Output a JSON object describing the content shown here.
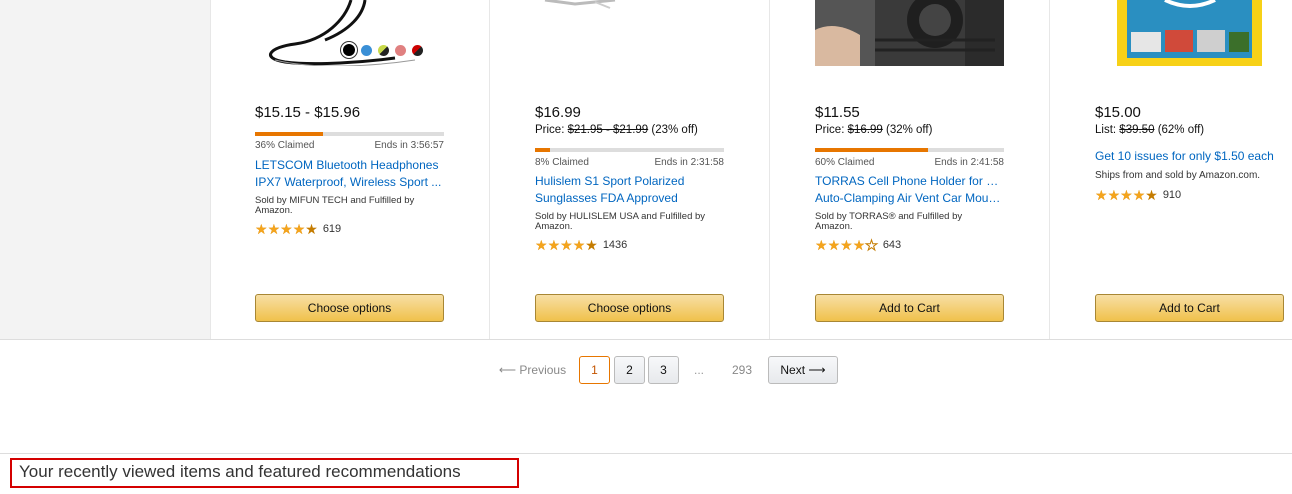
{
  "deals": [
    {
      "price": "$15.15 - $15.96",
      "claimed_percent": 36,
      "claimed_text": "36% Claimed",
      "ends_text": "Ends in 3:56:57",
      "title_line1": "LETSCOM Bluetooth Headphones",
      "title_line2": "IPX7 Waterproof, Wireless Sport ...",
      "sold_by_line1": "Sold by MIFUN TECH and Fulfilled by",
      "sold_by_line2": "Amazon.",
      "rating_stars": 4.5,
      "review_count": "619",
      "button_label": "Choose options"
    },
    {
      "price": "$16.99",
      "list_label": "Price:",
      "list_price": "$21.95 - $21.99",
      "discount": "(23% off)",
      "claimed_percent": 8,
      "claimed_text": "8% Claimed",
      "ends_text": "Ends in 2:31:58",
      "title_line1": "Hulislem S1 Sport Polarized",
      "title_line2": "Sunglasses FDA Approved",
      "sold_by_line1": "Sold by HULISLEM USA and Fulfilled by",
      "sold_by_line2": "Amazon.",
      "rating_stars": 4.5,
      "review_count": "1436",
      "button_label": "Choose options"
    },
    {
      "price": "$11.55",
      "list_label": "Price:",
      "list_price": "$16.99",
      "discount": "(32% off)",
      "claimed_percent": 60,
      "claimed_text": "60% Claimed",
      "ends_text": "Ends in 2:41:58",
      "title_line1": "TORRAS Cell Phone Holder for Car,",
      "title_line2": "Auto-Clamping Air Vent Car Moun...",
      "sold_by_line1": "Sold by TORRAS® and Fulfilled by",
      "sold_by_line2": "Amazon.",
      "rating_stars": 4,
      "review_count": "643",
      "button_label": "Add to Cart"
    },
    {
      "price": "$15.00",
      "list_label": "List:",
      "list_price": "$39.50",
      "discount": "(62% off)",
      "title_line1": "Get 10 issues for only $1.50 each",
      "ships_text": "Ships from and sold by Amazon.com.",
      "rating_stars": 4.5,
      "review_count": "910",
      "button_label": "Add to Cart"
    }
  ],
  "pagination": {
    "previous": "Previous",
    "pages": [
      "1",
      "2",
      "3"
    ],
    "ellipsis": "...",
    "last_page": "293",
    "next": "Next",
    "current_page": "1"
  },
  "recently_viewed": {
    "title": "Your recently viewed items and featured recommendations"
  },
  "colors": {
    "accent": "#e77600",
    "link": "#0066c0",
    "star": "#f4a41d",
    "button": "#f0c14b",
    "highlight_border": "#d40000"
  },
  "swatches": [
    "#000000",
    "#3a8fd6",
    "#3c6b2a",
    "#e08080",
    "#cc0000"
  ]
}
